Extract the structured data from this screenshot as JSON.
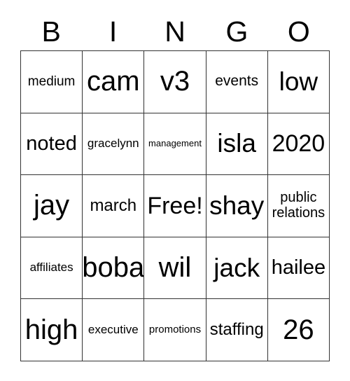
{
  "card": {
    "type": "bingo-card",
    "headers": [
      "B",
      "I",
      "N",
      "G",
      "O"
    ],
    "rows": [
      [
        {
          "text": "medium",
          "size": "fs-sm"
        },
        {
          "text": "cam",
          "size": "fs-3xl"
        },
        {
          "text": "v3",
          "size": "fs-3xl"
        },
        {
          "text": "events",
          "size": "fs-m"
        },
        {
          "text": "low",
          "size": "fs-xxl"
        }
      ],
      [
        {
          "text": "noted",
          "size": "fs-l"
        },
        {
          "text": "gracelynn",
          "size": "fs-s"
        },
        {
          "text": "management",
          "size": "fs-xxs"
        },
        {
          "text": "isla",
          "size": "fs-xxl"
        },
        {
          "text": "2020",
          "size": "fs-xl"
        }
      ],
      [
        {
          "text": "jay",
          "size": "fs-3xl"
        },
        {
          "text": "march",
          "size": "fs-ml"
        },
        {
          "text": "Free!",
          "size": "fs-xl"
        },
        {
          "text": "shay",
          "size": "fs-xxl"
        },
        {
          "text": "public\nrelations",
          "size": "fs-wrap"
        }
      ],
      [
        {
          "text": "affiliates",
          "size": "fs-s"
        },
        {
          "text": "boba",
          "size": "fs-3xl"
        },
        {
          "text": "wil",
          "size": "fs-3xl"
        },
        {
          "text": "jack",
          "size": "fs-xxl"
        },
        {
          "text": "hailee",
          "size": "fs-l"
        }
      ],
      [
        {
          "text": "high",
          "size": "fs-3xl"
        },
        {
          "text": "executive",
          "size": "fs-s"
        },
        {
          "text": "promotions",
          "size": "fs-xs"
        },
        {
          "text": "staffing",
          "size": "fs-ml"
        },
        {
          "text": "26",
          "size": "fs-3xl"
        }
      ]
    ],
    "colors": {
      "background": "#ffffff",
      "border": "#333333",
      "text": "#000000"
    }
  }
}
